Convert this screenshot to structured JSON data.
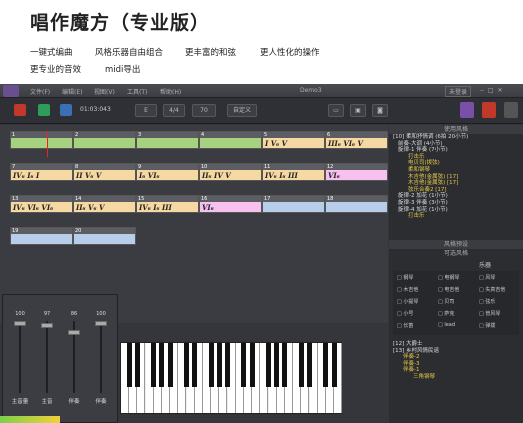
{
  "promo": {
    "title": "唱作魔方（专业版）",
    "features_row1": [
      "一键式编曲",
      "风格乐器自由组合",
      "更丰富的和弦",
      "更人性化的操作"
    ],
    "features_row2": [
      "更专业的音效",
      "midi导出"
    ]
  },
  "app": {
    "menu": [
      "文件(F)",
      "编辑(E)",
      "视图(V)",
      "工具(T)",
      "帮助(H)"
    ],
    "window_title": "Demo3",
    "login": "未登录",
    "toolbar": {
      "time": "01:03:043",
      "key": "E",
      "meter": "4/4",
      "tempo": "70",
      "custom": "自定义"
    },
    "measures": [
      {
        "n": "1",
        "chords": "",
        "color": "green"
      },
      {
        "n": "2",
        "chords": "",
        "color": "green"
      },
      {
        "n": "3",
        "chords": "",
        "color": "green"
      },
      {
        "n": "4",
        "chords": "",
        "color": "green"
      },
      {
        "n": "5",
        "chords": "I    V₆  V",
        "color": "orange"
      },
      {
        "n": "6",
        "chords": "III₆   VI₆  V",
        "color": "orange"
      },
      {
        "n": "7",
        "chords": "IV₆   I₆  I",
        "color": "orange"
      },
      {
        "n": "8",
        "chords": "II   V₆  V",
        "color": "orange"
      },
      {
        "n": "9",
        "chords": "I₆   VI₆",
        "color": "orange"
      },
      {
        "n": "10",
        "chords": "II₆  IV  V",
        "color": "orange"
      },
      {
        "n": "11",
        "chords": "IV₆   I₆  III",
        "color": "orange"
      },
      {
        "n": "12",
        "chords": "VI₆",
        "color": "pink"
      },
      {
        "n": "13",
        "chords": "IV₆  VI₆ VI₆",
        "color": "orange"
      },
      {
        "n": "14",
        "chords": "II₆   V₆  V",
        "color": "orange"
      },
      {
        "n": "15",
        "chords": "IV₆   I₆  III",
        "color": "orange"
      },
      {
        "n": "16",
        "chords": "VI₆",
        "color": "pink"
      },
      {
        "n": "17",
        "chords": "",
        "color": "blue"
      },
      {
        "n": "18",
        "chords": "",
        "color": "blue"
      },
      {
        "n": "19",
        "chords": "",
        "color": "blue"
      },
      {
        "n": "20",
        "chords": "",
        "color": "blue"
      }
    ],
    "mixer": [
      {
        "value": "100",
        "label": "主音量",
        "level": 1.0
      },
      {
        "value": "97",
        "label": "主音",
        "level": 0.97
      },
      {
        "value": "86",
        "label": "伴奏",
        "level": 0.86
      },
      {
        "value": "100",
        "label": "伴奏",
        "level": 1.0
      }
    ],
    "right": {
      "style_header": "使用风格",
      "style_tree": [
        "[10] 柔和抒情调 (6拍 20小节)",
        "前奏-大调 (4小节)",
        "旋律-1 伴奏 (7小节)",
        "打击乐",
        "电贝司(拨弦)",
        "柔和钢琴",
        "木吉他(金属弦) [17]",
        "木吉他(金属弦) [17]",
        "弦乐合奏2 [17]",
        "旋律-2 加花 (1小节)",
        "旋律-3 伴奏 (3小节)",
        "旋律-4 加花 (1小节)",
        "打击乐"
      ],
      "preview_header": "风格预设",
      "avail_header": "可选风格",
      "tab_label": "乐器",
      "checks": [
        "钢琴",
        "电钢琴",
        "风琴",
        "木吉他",
        "电吉他",
        "失真吉他",
        "小提琴",
        "贝司",
        "弦乐",
        "小号",
        "萨克",
        "管风琴",
        "长笛",
        "lead",
        "弹拨"
      ],
      "bottom_tree": [
        "[12] 大爵士",
        "[13] 乡村风情民谣",
        "伴奏-2",
        "伴奏-3",
        "伴奏-1",
        "三角钢琴"
      ]
    }
  }
}
